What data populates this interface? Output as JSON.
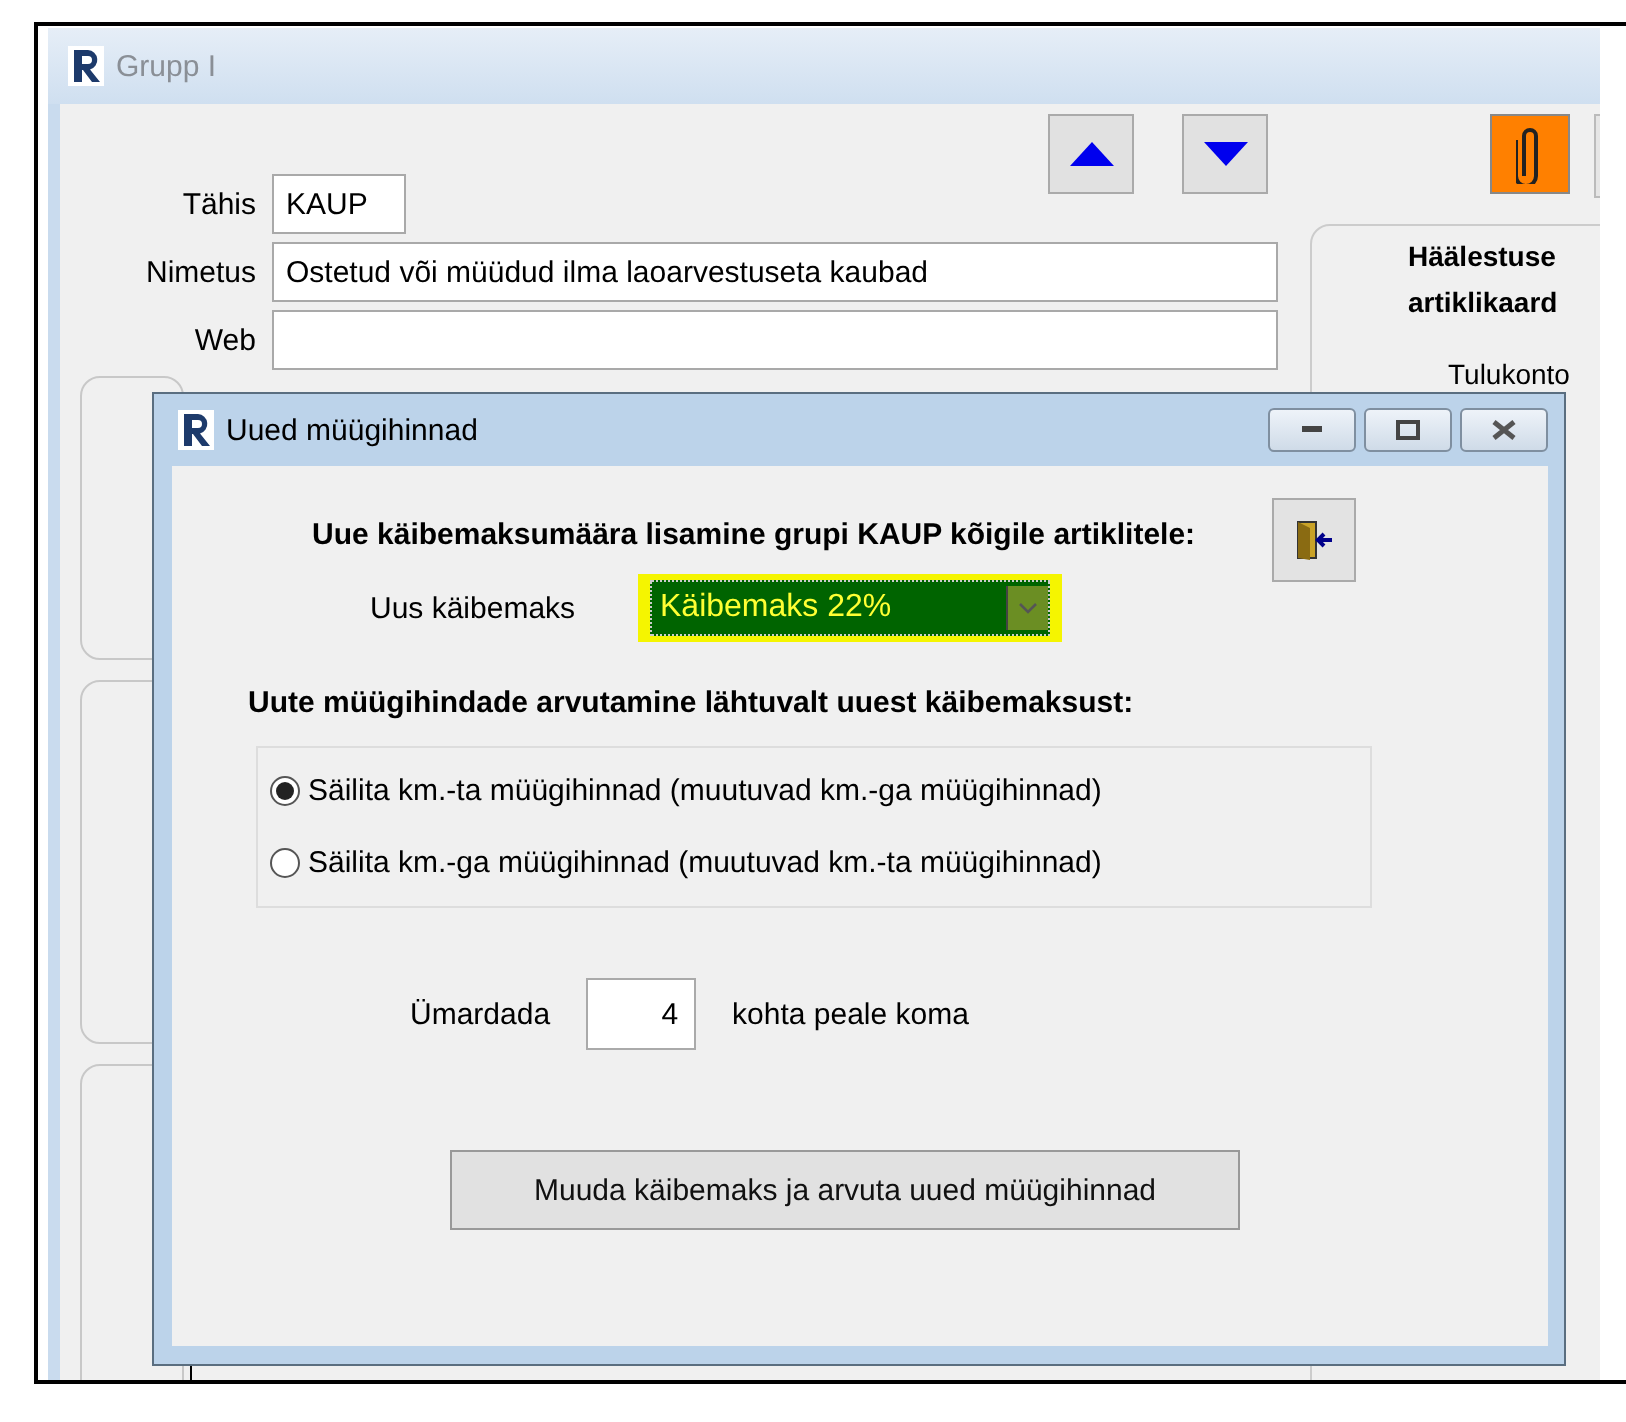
{
  "background_window": {
    "title": "Grupp I",
    "fields": [
      {
        "label": "Tähis",
        "value": "KAUP"
      },
      {
        "label": "Nimetus",
        "value": "Ostetud või müüdud ilma laoarvestuseta kaubad"
      },
      {
        "label": "Web"
      }
    ],
    "right_panel": {
      "heading_lines": [
        "Häälestuse",
        "artiklikaard"
      ],
      "label": "Tulukonto"
    }
  },
  "dialog": {
    "title": "Uued müügihinnad",
    "heading": "Uue käibemaksumäära lisamine grupi KAUP kõigile artiklitele:",
    "vat_label": "Uus käibemaks",
    "vat_value": "Käibemaks 22%",
    "vat_highlighted": true,
    "calc_heading": "Uute müügihindade arvutamine lähtuvalt uuest käibemaksust:",
    "options": [
      {
        "label": "Säilita km.-ta müügihinnad (muutuvad km.-ga müügihinnad)",
        "selected": true
      },
      {
        "label": "Säilita km.-ga müügihinnad (muutuvad km.-ta müügihinnad)",
        "selected": false
      }
    ],
    "rounding": {
      "label": "Ümardada",
      "value": "4",
      "suffix": "kohta peale koma"
    },
    "action_button": "Muuda käibemaks ja arvuta uued müügihinnad"
  }
}
